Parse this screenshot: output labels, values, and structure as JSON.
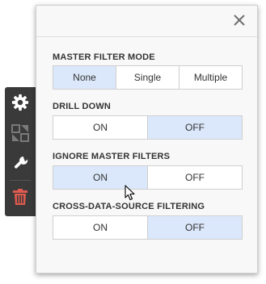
{
  "icons": {
    "settings": "gear-icon",
    "interactivity": "interactivity-icon",
    "options": "wrench-icon",
    "delete": "trash-icon",
    "close": "close-icon"
  },
  "colors": {
    "toolbar_bg": "#3a3a3a",
    "icon_white": "#ffffff",
    "icon_dim": "#7a7a7a",
    "delete_red": "#e05a4f",
    "selected_bg": "#dbe8fb"
  },
  "sections": {
    "master_filter": {
      "title": "MASTER FILTER MODE",
      "options": [
        "None",
        "Single",
        "Multiple"
      ],
      "selected": "None"
    },
    "drill_down": {
      "title": "DRILL DOWN",
      "options": [
        "ON",
        "OFF"
      ],
      "selected": "OFF"
    },
    "ignore_master": {
      "title": "IGNORE MASTER FILTERS",
      "options": [
        "ON",
        "OFF"
      ],
      "selected": "ON"
    },
    "cross_data": {
      "title": "CROSS-DATA-SOURCE FILTERING",
      "options": [
        "ON",
        "OFF"
      ],
      "selected": "OFF"
    }
  }
}
